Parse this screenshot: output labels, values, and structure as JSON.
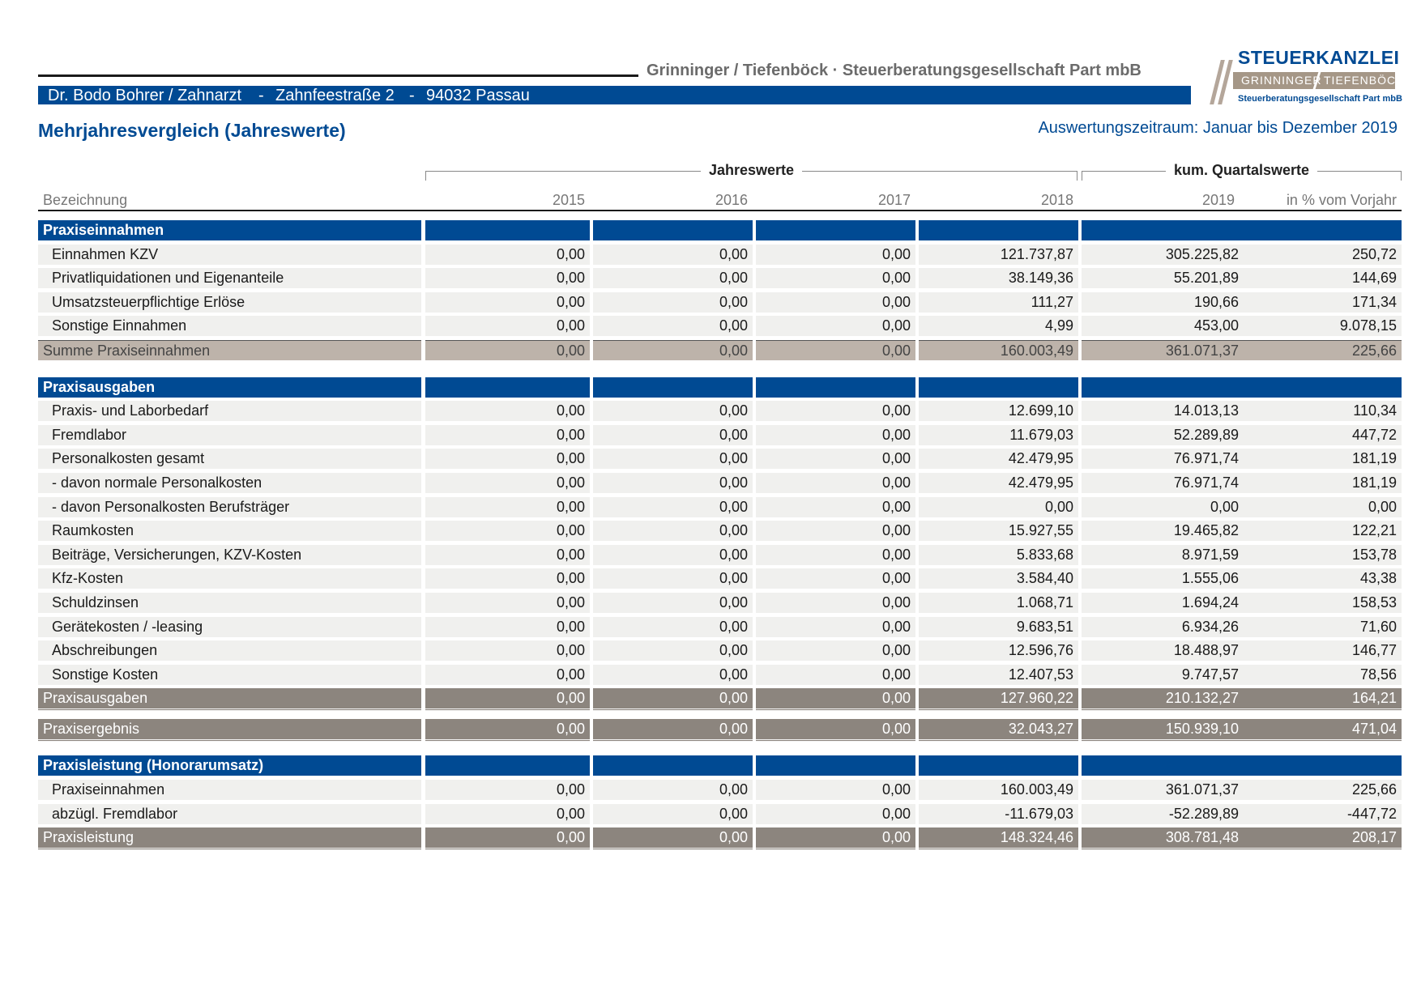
{
  "header": {
    "firm": "Grinninger / Tiefenböck · Steuerberatungsgesellschaft Part mbB",
    "client_name": "Dr. Bodo Bohrer / Zahnarzt",
    "client_sep1": "-",
    "client_street": "Zahnfeestraße 2",
    "client_sep2": "-",
    "client_city": "94032 Passau"
  },
  "logo": {
    "top": "STEUERKANZLEI",
    "band_left": "GRINNINGER",
    "band_right": "TIEFENBÖCK",
    "sub": "Steuerberatungsgesellschaft Part mbB"
  },
  "title": "Mehrjahresvergleich (Jahreswerte)",
  "period": "Auswertungszeitraum: Januar bis Dezember 2019",
  "groups": {
    "annual": "Jahreswerte",
    "quarterly": "kum. Quartalswerte"
  },
  "columns": [
    "Bezeichnung",
    "2015",
    "2016",
    "2017",
    "2018",
    "2019",
    "in % vom Vorjahr"
  ],
  "rows": [
    {
      "type": "section",
      "label": "Praxiseinnahmen"
    },
    {
      "type": "item",
      "label": "Einnahmen KZV",
      "v": [
        "0,00",
        "0,00",
        "0,00",
        "121.737,87",
        "305.225,82",
        "250,72"
      ]
    },
    {
      "type": "item",
      "label": "Privatliquidationen und Eigenanteile",
      "v": [
        "0,00",
        "0,00",
        "0,00",
        "38.149,36",
        "55.201,89",
        "144,69"
      ]
    },
    {
      "type": "item",
      "label": "Umsatzsteuerpflichtige Erlöse",
      "v": [
        "0,00",
        "0,00",
        "0,00",
        "111,27",
        "190,66",
        "171,34"
      ]
    },
    {
      "type": "item",
      "label": "Sonstige Einnahmen",
      "v": [
        "0,00",
        "0,00",
        "0,00",
        "4,99",
        "453,00",
        "9.078,15"
      ]
    },
    {
      "type": "sum",
      "label": "Summe Praxiseinnahmen",
      "v": [
        "0,00",
        "0,00",
        "0,00",
        "160.003,49",
        "361.071,37",
        "225,66"
      ]
    },
    {
      "type": "gap"
    },
    {
      "type": "section",
      "label": "Praxisausgaben"
    },
    {
      "type": "item",
      "label": "Praxis- und Laborbedarf",
      "v": [
        "0,00",
        "0,00",
        "0,00",
        "12.699,10",
        "14.013,13",
        "110,34"
      ]
    },
    {
      "type": "item",
      "label": "Fremdlabor",
      "v": [
        "0,00",
        "0,00",
        "0,00",
        "11.679,03",
        "52.289,89",
        "447,72"
      ]
    },
    {
      "type": "item",
      "label": "Personalkosten gesamt",
      "v": [
        "0,00",
        "0,00",
        "0,00",
        "42.479,95",
        "76.971,74",
        "181,19"
      ]
    },
    {
      "type": "item",
      "label": "- davon normale Personalkosten",
      "v": [
        "0,00",
        "0,00",
        "0,00",
        "42.479,95",
        "76.971,74",
        "181,19"
      ]
    },
    {
      "type": "item",
      "label": "- davon Personalkosten Berufsträger",
      "v": [
        "0,00",
        "0,00",
        "0,00",
        "0,00",
        "0,00",
        "0,00"
      ]
    },
    {
      "type": "item",
      "label": "Raumkosten",
      "v": [
        "0,00",
        "0,00",
        "0,00",
        "15.927,55",
        "19.465,82",
        "122,21"
      ]
    },
    {
      "type": "item",
      "label": "Beiträge, Versicherungen, KZV-Kosten",
      "v": [
        "0,00",
        "0,00",
        "0,00",
        "5.833,68",
        "8.971,59",
        "153,78"
      ]
    },
    {
      "type": "item",
      "label": "Kfz-Kosten",
      "v": [
        "0,00",
        "0,00",
        "0,00",
        "3.584,40",
        "1.555,06",
        "43,38"
      ]
    },
    {
      "type": "item",
      "label": "Schuldzinsen",
      "v": [
        "0,00",
        "0,00",
        "0,00",
        "1.068,71",
        "1.694,24",
        "158,53"
      ]
    },
    {
      "type": "item",
      "label": "Gerätekosten / -leasing",
      "v": [
        "0,00",
        "0,00",
        "0,00",
        "9.683,51",
        "6.934,26",
        "71,60"
      ]
    },
    {
      "type": "item",
      "label": "Abschreibungen",
      "v": [
        "0,00",
        "0,00",
        "0,00",
        "12.596,76",
        "18.488,97",
        "146,77"
      ]
    },
    {
      "type": "item",
      "label": "Sonstige Kosten",
      "v": [
        "0,00",
        "0,00",
        "0,00",
        "12.407,53",
        "9.747,57",
        "78,56"
      ]
    },
    {
      "type": "total",
      "label": "Praxisausgaben",
      "v": [
        "0,00",
        "0,00",
        "0,00",
        "127.960,22",
        "210.132,27",
        "164,21"
      ]
    },
    {
      "type": "gap-s"
    },
    {
      "type": "total",
      "label": "Praxisergebnis",
      "v": [
        "0,00",
        "0,00",
        "0,00",
        "32.043,27",
        "150.939,10",
        "471,04"
      ]
    },
    {
      "type": "gap"
    },
    {
      "type": "section",
      "label": "Praxisleistung (Honorarumsatz)"
    },
    {
      "type": "item",
      "label": "Praxiseinnahmen",
      "v": [
        "0,00",
        "0,00",
        "0,00",
        "160.003,49",
        "361.071,37",
        "225,66"
      ]
    },
    {
      "type": "item",
      "label": "abzügl. Fremdlabor",
      "v": [
        "0,00",
        "0,00",
        "0,00",
        "-11.679,03",
        "-52.289,89",
        "-447,72"
      ]
    },
    {
      "type": "total",
      "label": "Praxisleistung",
      "v": [
        "0,00",
        "0,00",
        "0,00",
        "148.324,46",
        "308.781,48",
        "208,17"
      ]
    }
  ],
  "colors": {
    "brand_blue": "#004a93",
    "sum_row": "#bdb3aa",
    "total_row": "#8c857e",
    "item_row": "#f0f0ee"
  }
}
